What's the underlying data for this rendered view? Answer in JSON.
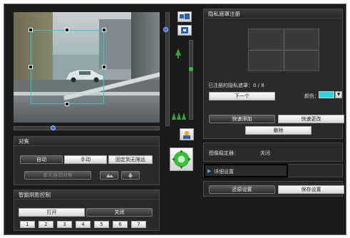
{
  "colors": {
    "accent": "#28d6e6",
    "roi": "#2ec8c8",
    "bg": "#1b1b1b"
  },
  "focus": {
    "title": "对焦",
    "auto_label": "自动",
    "manual_label": "手动",
    "fixed_infinity_label": "固定到无限远",
    "one_shot_af_label": "单次自动对焦"
  },
  "smart_shade": {
    "title": "智能阴影控制",
    "on_label": "打开",
    "off_label": "关闭",
    "levels": [
      "1",
      "2",
      "3",
      "4",
      "5",
      "6",
      "7"
    ]
  },
  "privacy_mask": {
    "title": "隐私遮罩注册",
    "registered_label": "已注册的隐私遮罩：0 / 8",
    "next_label": "下一个",
    "color_label": "颜色：",
    "quick_add_label": "快速添加",
    "quick_change_label": "快速更改",
    "delete_label": "删除"
  },
  "stabilizer": {
    "label": "图像稳定器：",
    "value": "关闭"
  },
  "detail_settings_label": "详细设置",
  "restore_label": "还原设置",
  "save_label": "保存设置",
  "icons": {
    "zoom_wide": "zoom-wide-icon",
    "zoom_tele": "zoom-tele-icon",
    "backlight": "backlight-icon",
    "pan_tilt": "pan-tilt-joystick-icon",
    "expand": "triangle-right-icon",
    "dropdown": "chevron-down-icon"
  }
}
